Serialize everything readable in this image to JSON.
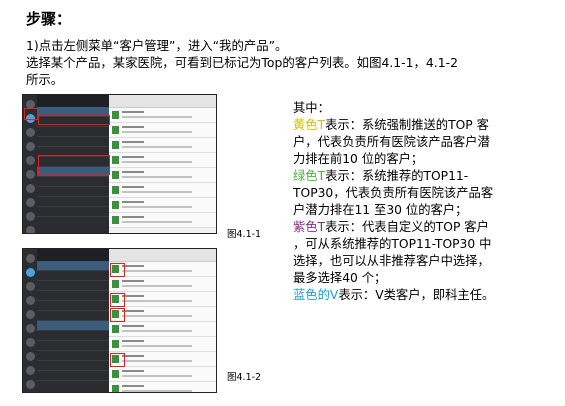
{
  "heading": "步骤：",
  "intro": {
    "line1": "1)点击左侧菜单“客户管理”，进入“我的产品”。",
    "line2": "选择某个产品，某家医院，可看到已标记为Top的客户列表。如图4.1-1，4.1-2",
    "line3": "所示。"
  },
  "figures": [
    {
      "caption": "图4.1-1"
    },
    {
      "caption": "图4.1-2"
    }
  ],
  "notes": {
    "intro": "其中：",
    "yellow": {
      "keyword": "黄色T",
      "line1_rest": "表示：系统强制推送的TOP 客",
      "line2": "户，代表负责所有医院该产品客户潜",
      "line3": "力排在前10 位的客户；"
    },
    "green": {
      "keyword": "绿色T",
      "line1_rest": "表示：系统推荐的TOP11-",
      "line2": "TOP30，代表负责所有医院该产品客",
      "line3": "户潜力排在11 至30 位的客户；"
    },
    "purple": {
      "keyword": "紫色T",
      "line1_rest": "表示：代表自定义的TOP 客户",
      "line2": "，可从系统推荐的TOP11-TOP30 中",
      "line3": "选择，也可以从非推荐客户中选择，",
      "line4": "最多选择40 个；"
    },
    "blue": {
      "keyword": "蓝色的V",
      "line1_rest": "表示：V类客户，即科主任。"
    }
  },
  "colors": {
    "yellow": "#d8c100",
    "green": "#4bb33a",
    "purple": "#8b2a8b",
    "blue": "#1aa0d6",
    "highlight_box": "#e02020"
  }
}
